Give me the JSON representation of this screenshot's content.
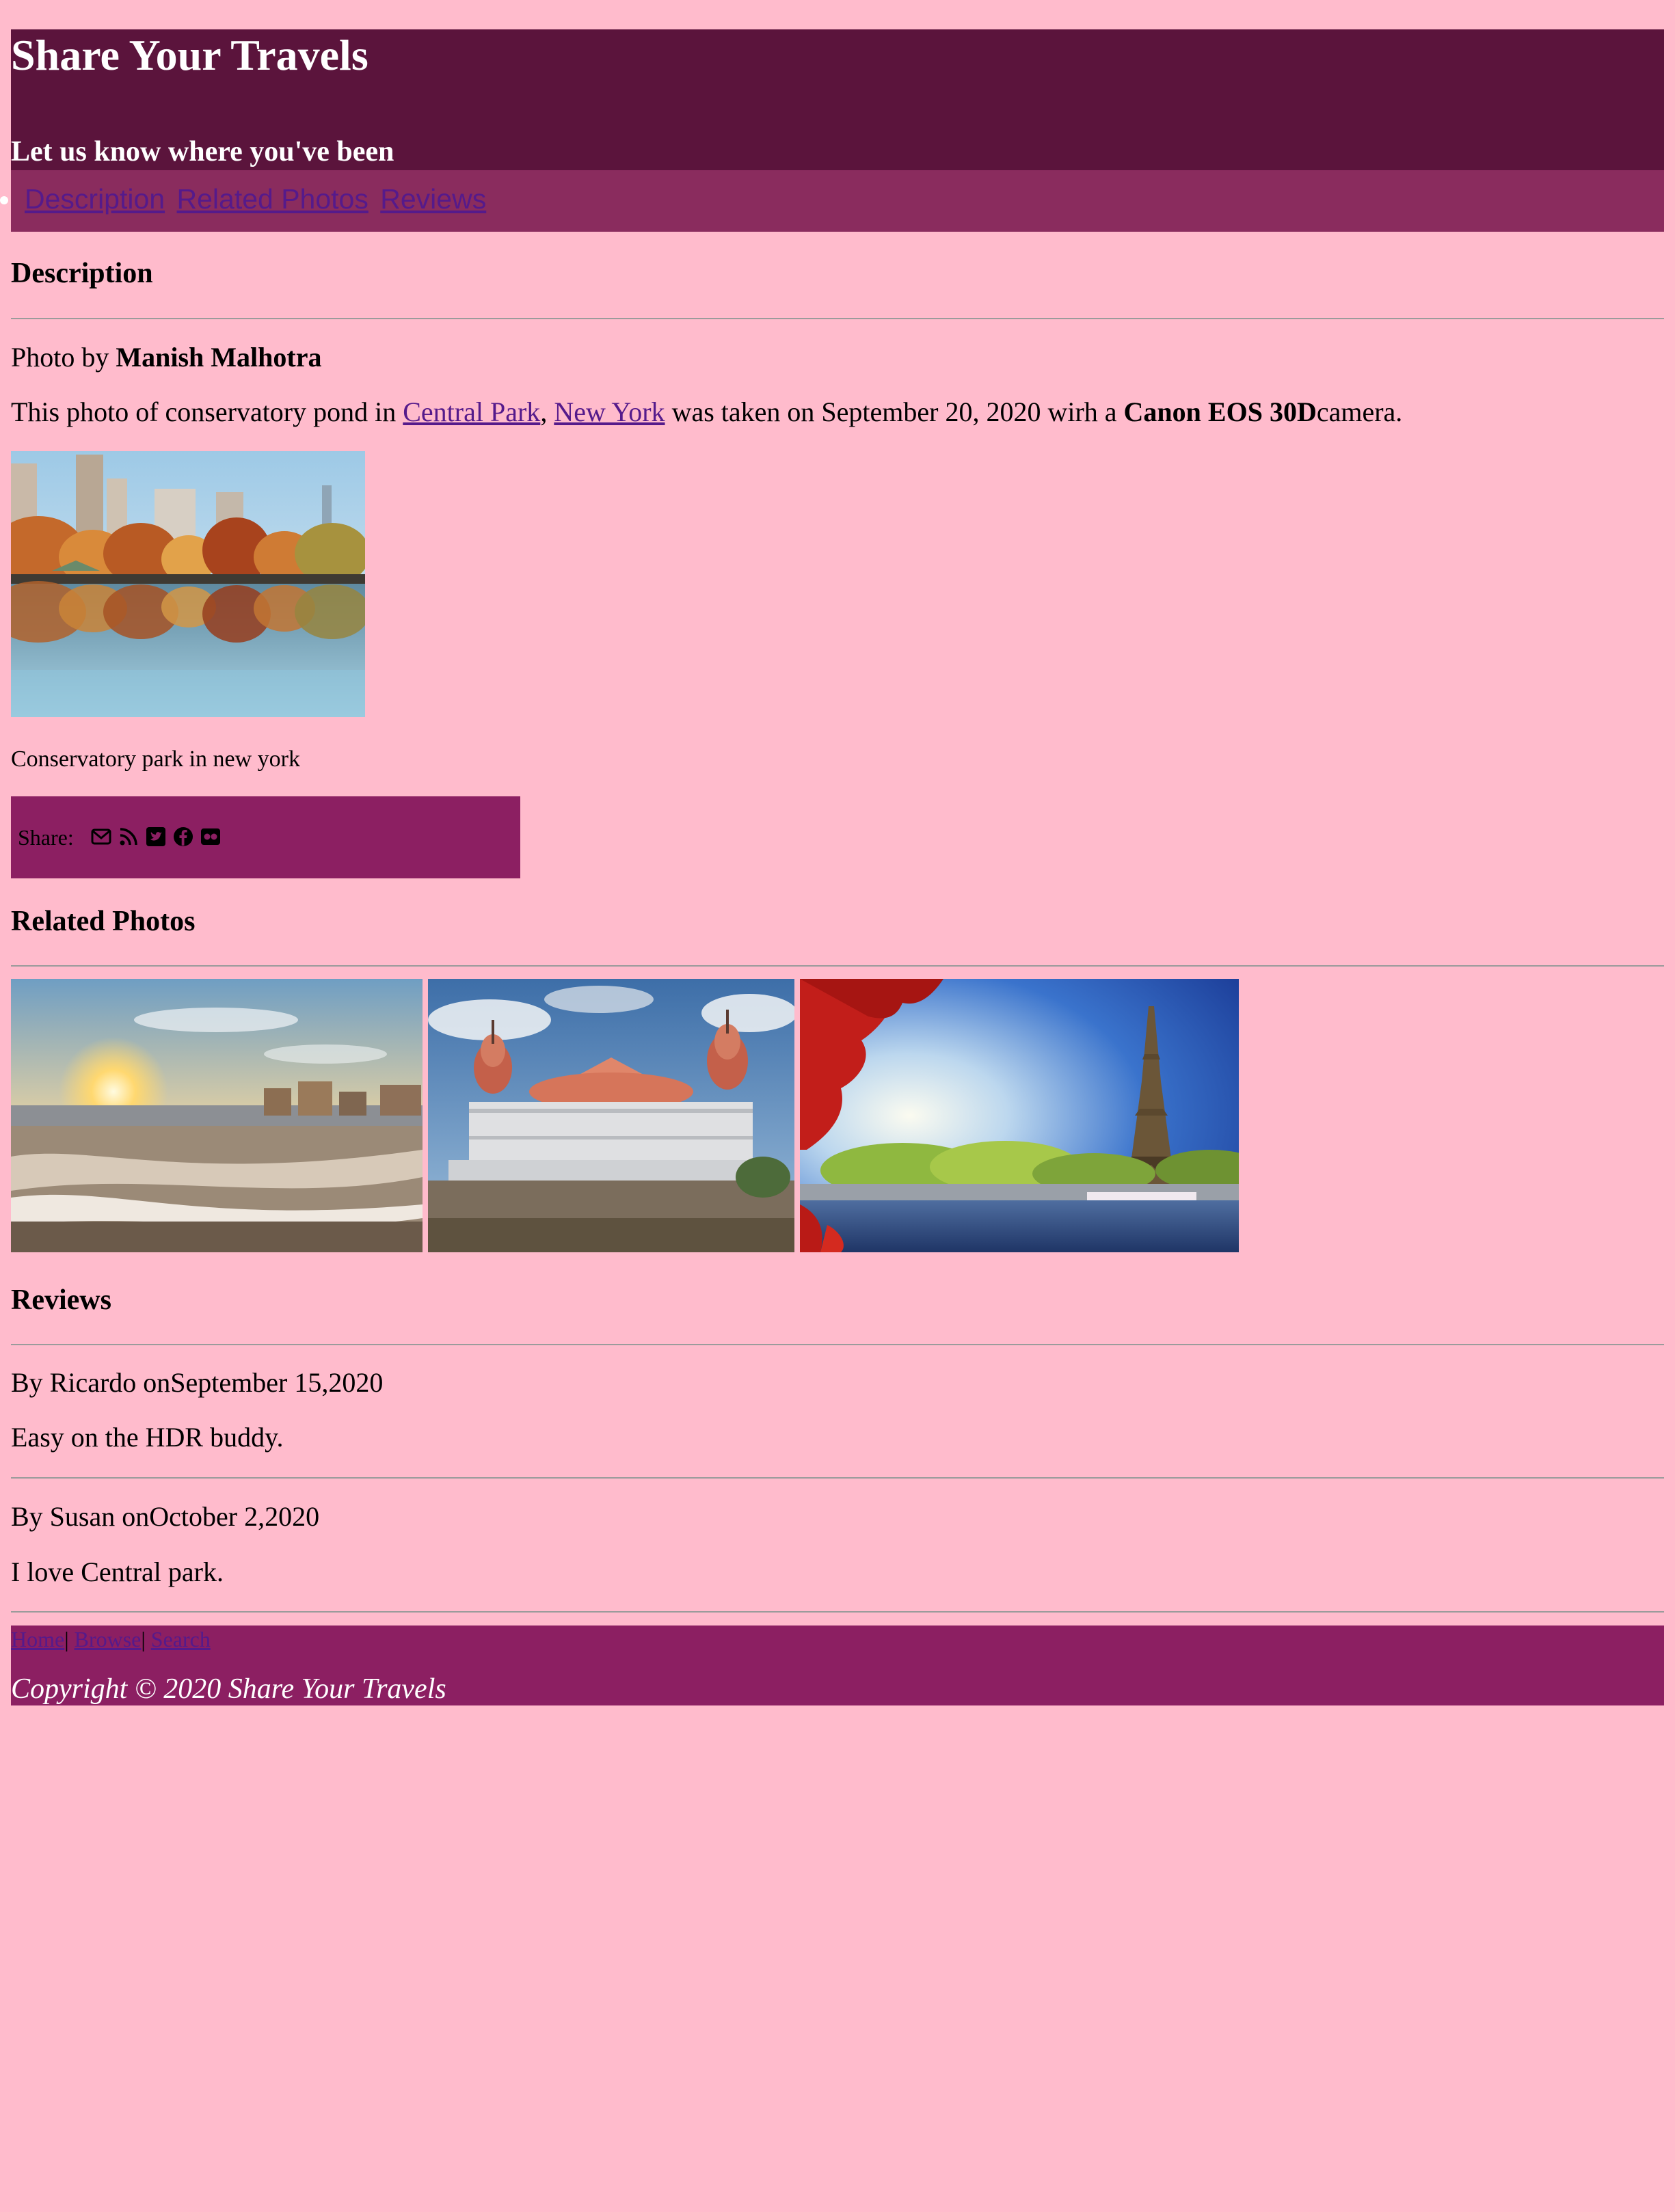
{
  "header": {
    "title": "Share Your Travels",
    "tagline": "Let us know where you've been"
  },
  "nav": {
    "items": [
      "Description",
      "Related Photos",
      "Reviews"
    ]
  },
  "description": {
    "heading": "Description",
    "photo_by_prefix": "Photo by ",
    "photographer": "Manish Malhotra",
    "sentence_start": "This photo of conservatory pond in ",
    "link_park": "Central Park",
    "comma": ", ",
    "link_city": "New York",
    "sentence_mid": " was taken on September 20, 2020 wirh a ",
    "camera": "Canon EOS 30D",
    "sentence_end": "camera.",
    "photo_alt": "Conservatory pond in Central Park",
    "caption": "Conservatory park in new york"
  },
  "share": {
    "label": "Share: ",
    "icons": [
      "envelope-icon",
      "rss-icon",
      "twitter-icon",
      "facebook-icon",
      "flickr-icon"
    ]
  },
  "related": {
    "heading": "Related Photos"
  },
  "reviews": {
    "heading": "Reviews",
    "items": [
      {
        "byline": "By Ricardo onSeptember 15,2020",
        "text": "Easy on the HDR buddy."
      },
      {
        "byline": "By Susan onOctober 2,2020",
        "text": "I love Central park."
      }
    ]
  },
  "footer": {
    "links": [
      "Home",
      "Browse",
      "Search"
    ],
    "separator": "|",
    "copyright": "Copyright © 2020 Share Your Travels"
  },
  "colors": {
    "page_bg": "#ffbbcc",
    "header_bg": "#5b143c",
    "nav_bg": "#8a2c5e",
    "share_bg": "#8c1f62",
    "footer_bg": "#8c1f62",
    "link": "#551a8b"
  }
}
